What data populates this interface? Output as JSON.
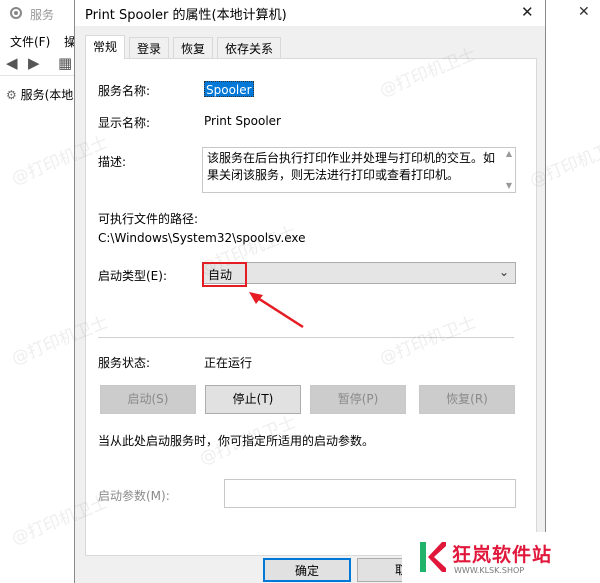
{
  "background_window": {
    "title": "服务",
    "menu": [
      "文件(F)",
      "操"
    ],
    "tree_item": "服务(本地"
  },
  "dialog": {
    "title": "Print Spooler 的属性(本地计算机)",
    "tabs": [
      "常规",
      "登录",
      "恢复",
      "依存关系"
    ],
    "active_tab": "常规",
    "fields": {
      "service_name_label": "服务名称:",
      "service_name_value": "Spooler",
      "display_name_label": "显示名称:",
      "display_name_value": "Print Spooler",
      "description_label": "描述:",
      "description_value": "该服务在后台执行打印作业并处理与打印机的交互。如果关闭该服务，则无法进行打印或查看打印机。",
      "path_label": "可执行文件的路径:",
      "path_value": "C:\\Windows\\System32\\spoolsv.exe",
      "startup_type_label": "启动类型(E):",
      "startup_type_value": "自动",
      "status_label": "服务状态:",
      "status_value": "正在运行"
    },
    "buttons": {
      "start": "启动(S)",
      "stop": "停止(T)",
      "pause": "暂停(P)",
      "resume": "恢复(R)"
    },
    "hint_text": "当从此处启动服务时，你可指定所适用的启动参数。",
    "param_label": "启动参数(M):",
    "param_value": "",
    "footer": {
      "ok": "确定",
      "cancel": "取"
    }
  },
  "watermark_text": "@打印机卫士",
  "logo": {
    "name": "狂岚软件站",
    "url": "WWW.KLSK.SHOP"
  },
  "colors": {
    "selection": "#0078d7",
    "highlight_box": "#e51c23",
    "logo_red": "#e0173a"
  }
}
